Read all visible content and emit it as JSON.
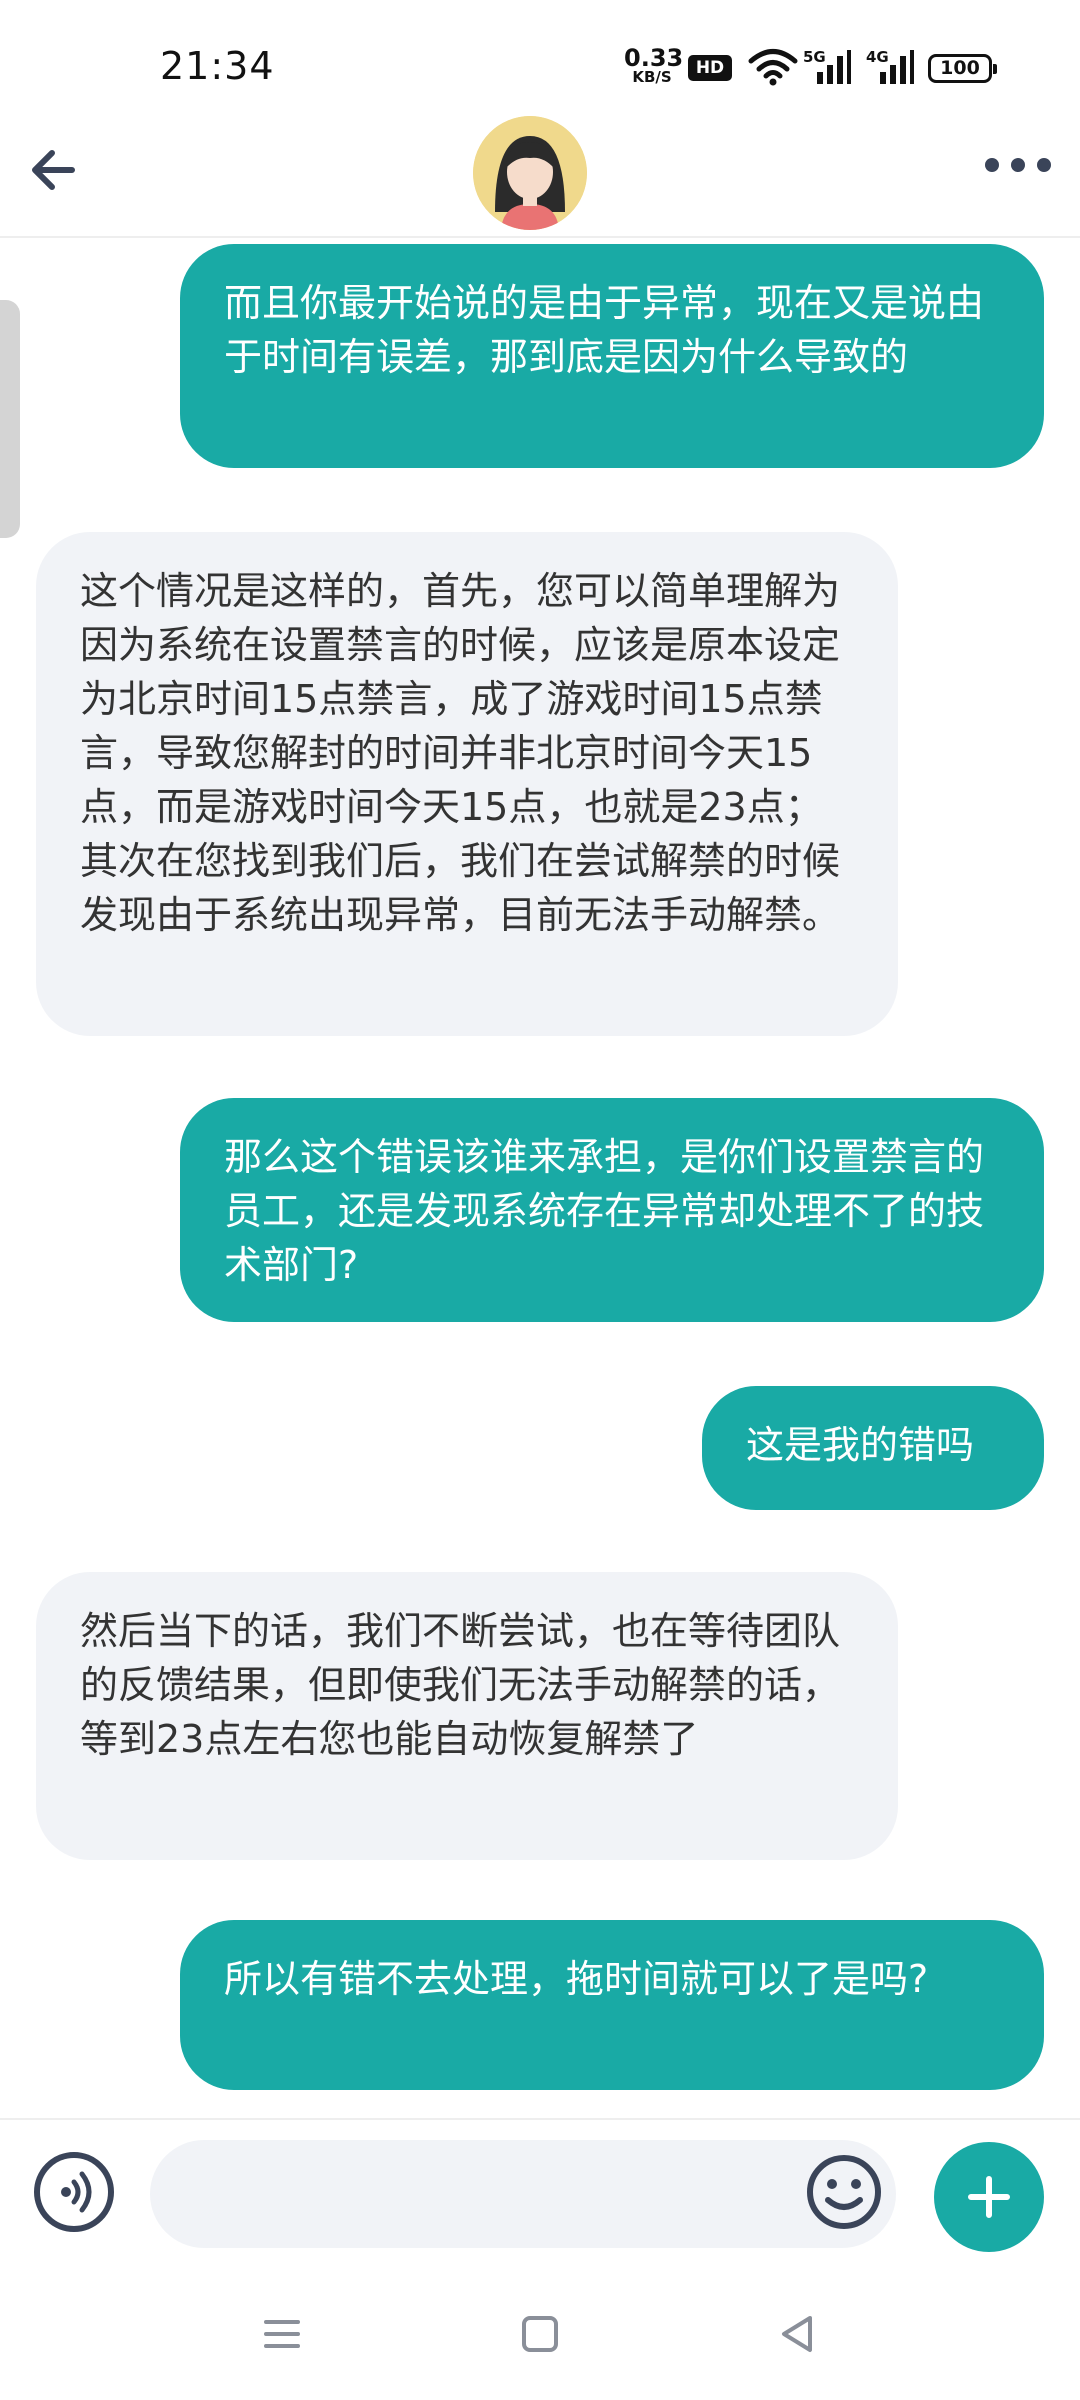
{
  "status_bar": {
    "time": "21:34",
    "net_speed_value": "0.33",
    "net_speed_unit": "KB/S",
    "hd_label": "HD",
    "signal_1_label": "5G",
    "signal_2_label": "4G",
    "battery": "100",
    "icons": [
      "hd-icon",
      "wifi-icon",
      "signal-icon",
      "battery-icon"
    ]
  },
  "header": {
    "back_icon": "arrow-left-icon",
    "avatar": "cartoon-girl-avatar",
    "more_icon": "more-horizontal-icon"
  },
  "messages": [
    {
      "sender": "me",
      "text": "而且你最开始说的是由于异常，现在又是说由于时间有误差，那到底是因为什么导致的"
    },
    {
      "sender": "them",
      "text": "这个情况是这样的，首先，您可以简单理解为因为系统在设置禁言的时候，应该是原本设定为北京时间15点禁言，成了游戏时间15点禁言，导致您解封的时间并非北京时间今天15点，而是游戏时间今天15点，也就是23点；其次在您找到我们后，我们在尝试解禁的时候发现由于系统出现异常，目前无法手动解禁。"
    },
    {
      "sender": "me",
      "text": "那么这个错误该谁来承担，是你们设置禁言的员工，还是发现系统存在异常却处理不了的技术部门?"
    },
    {
      "sender": "me",
      "text": "这是我的错吗"
    },
    {
      "sender": "them",
      "text": "然后当下的话，我们不断尝试，也在等待团队的反馈结果，但即使我们无法手动解禁的话，等到23点左右您也能自动恢复解禁了"
    },
    {
      "sender": "me",
      "text": "所以有错不去处理，拖时间就可以了是吗?"
    }
  ],
  "composer": {
    "voice_icon": "voice-icon",
    "input_value": "",
    "emoji_icon": "emoji-icon",
    "plus_icon": "plus-icon"
  },
  "nav_bar": {
    "icons": [
      "menu-icon",
      "home-icon",
      "back-triangle-icon"
    ]
  },
  "colors": {
    "accent": "#19aaa5",
    "incoming_bubble": "#f1f3f7",
    "text_dark": "#333333"
  }
}
